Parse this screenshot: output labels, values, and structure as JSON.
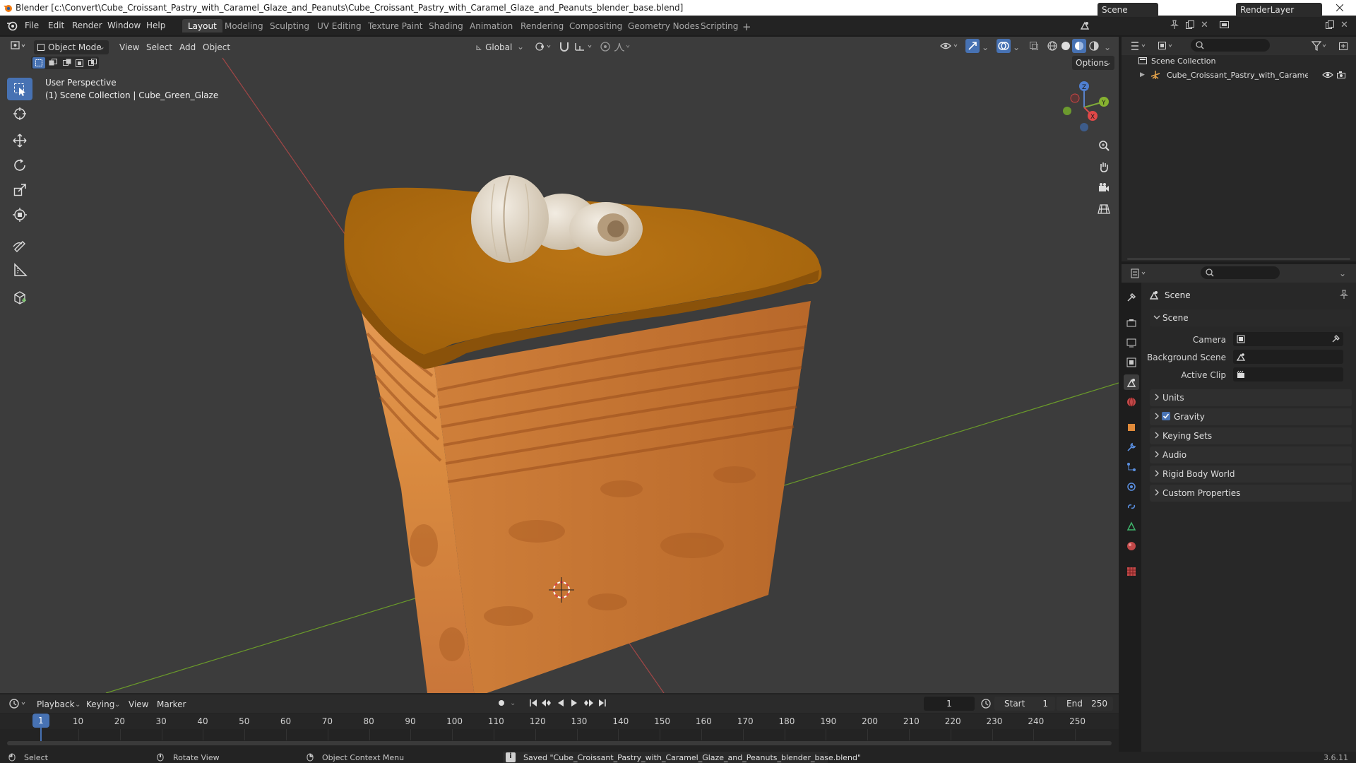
{
  "window": {
    "title": "Blender [c:\\Convert\\Cube_Croissant_Pastry_with_Caramel_Glaze_and_Peanuts\\Cube_Croissant_Pastry_with_Caramel_Glaze_and_Peanuts_blender_base.blend]"
  },
  "menus": [
    "File",
    "Edit",
    "Render",
    "Window",
    "Help"
  ],
  "workspaces": [
    "Layout",
    "Modeling",
    "Sculpting",
    "UV Editing",
    "Texture Paint",
    "Shading",
    "Animation",
    "Rendering",
    "Compositing",
    "Geometry Nodes",
    "Scripting"
  ],
  "active_workspace": "Layout",
  "scene_name": "Scene",
  "render_layer": "RenderLayer",
  "viewport": {
    "mode": "Object Mode",
    "menus": [
      "View",
      "Select",
      "Add",
      "Object"
    ],
    "orientation": "Global",
    "options": "Options",
    "overlay_title": "User Perspective",
    "overlay_sub": "(1) Scene Collection | Cube_Green_Glaze",
    "gizmo_axes": [
      "X",
      "Y",
      "Z"
    ]
  },
  "tools": [
    "select-box",
    "cursor",
    "move",
    "rotate",
    "scale",
    "transform",
    "annotate",
    "measure",
    "add-cube"
  ],
  "outliner": {
    "root": "Scene Collection",
    "items": [
      {
        "label": "Cube_Croissant_Pastry_with_Caramel_C"
      }
    ]
  },
  "properties": {
    "header": "Scene",
    "section": "Scene",
    "fields": [
      {
        "label": "Camera",
        "value": ""
      },
      {
        "label": "Background Scene",
        "value": ""
      },
      {
        "label": "Active Clip",
        "value": ""
      }
    ],
    "panels": [
      {
        "label": "Units",
        "checkbox": false
      },
      {
        "label": "Gravity",
        "checkbox": true
      },
      {
        "label": "Keying Sets",
        "checkbox": false
      },
      {
        "label": "Audio",
        "checkbox": false
      },
      {
        "label": "Rigid Body World",
        "checkbox": false
      },
      {
        "label": "Custom Properties",
        "checkbox": false
      }
    ]
  },
  "timeline": {
    "menus": [
      "Playback",
      "Keying",
      "View",
      "Marker"
    ],
    "current_frame": "1",
    "start_label": "Start",
    "start": "1",
    "end_label": "End",
    "end": "250",
    "ticks": [
      "1",
      "10",
      "20",
      "30",
      "40",
      "50",
      "60",
      "70",
      "80",
      "90",
      "100",
      "110",
      "120",
      "130",
      "140",
      "150",
      "160",
      "170",
      "180",
      "190",
      "200",
      "210",
      "220",
      "230",
      "240",
      "250"
    ]
  },
  "status": {
    "select": "Select",
    "rotate": "Rotate View",
    "context": "Object Context Menu",
    "message": "Saved \"Cube_Croissant_Pastry_with_Caramel_Glaze_and_Peanuts_blender_base.blend\"",
    "version": "3.6.11"
  },
  "colors": {
    "accent": "#4772b3",
    "axis_x": "#c04545",
    "axis_y": "#6c9a2e",
    "caramel": "#b3700d",
    "pastry": "#e0904a"
  }
}
